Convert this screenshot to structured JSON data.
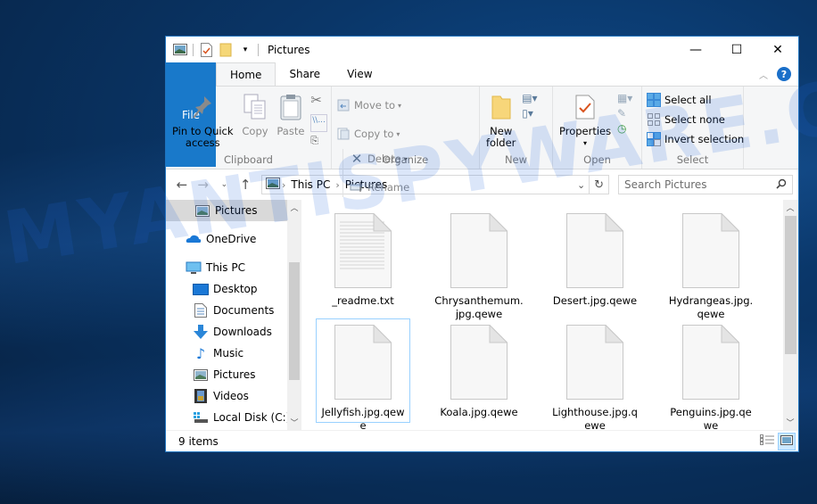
{
  "window": {
    "title": "Pictures",
    "controls": {
      "minimize": "—",
      "maximize": "☐",
      "close": "✕"
    }
  },
  "quick_access_toolbar": {
    "icons": [
      "pictures-folder-icon",
      "properties-icon",
      "new-folder-icon",
      "customize-dropdown-icon"
    ]
  },
  "ribbon_tabs": [
    {
      "label": "File"
    },
    {
      "label": "Home",
      "active": true
    },
    {
      "label": "Share"
    },
    {
      "label": "View"
    }
  ],
  "ribbon": {
    "clipboard": {
      "label": "Clipboard",
      "pin": "Pin to Quick access",
      "pin_line1": "Pin to Quick",
      "pin_line2": "access",
      "copy": "Copy",
      "paste": "Paste"
    },
    "organize": {
      "label": "Organize",
      "move_to": "Move to",
      "copy_to": "Copy to",
      "delete": "Delete",
      "rename": "Rename"
    },
    "new": {
      "label": "New",
      "new_folder_line1": "New",
      "new_folder_line2": "folder"
    },
    "open": {
      "label": "Open",
      "properties": "Properties"
    },
    "select": {
      "label": "Select",
      "select_all": "Select all",
      "select_none": "Select none",
      "invert_selection": "Invert selection"
    }
  },
  "address_bar": {
    "breadcrumbs": [
      "This PC",
      "Pictures"
    ],
    "search_placeholder": "Search Pictures"
  },
  "sidebar": {
    "items": [
      {
        "label": "Pictures",
        "icon": "pictures-icon",
        "selected": true
      },
      {
        "label": "OneDrive",
        "icon": "onedrive-icon"
      },
      {
        "label": "This PC",
        "icon": "this-pc-icon"
      },
      {
        "label": "Desktop",
        "icon": "desktop-icon"
      },
      {
        "label": "Documents",
        "icon": "documents-icon"
      },
      {
        "label": "Downloads",
        "icon": "downloads-icon"
      },
      {
        "label": "Music",
        "icon": "music-icon"
      },
      {
        "label": "Pictures",
        "icon": "pictures-icon"
      },
      {
        "label": "Videos",
        "icon": "videos-icon"
      },
      {
        "label": "Local Disk (C:)",
        "icon": "local-disk-icon"
      }
    ]
  },
  "files": [
    {
      "name": "_readme.txt",
      "type": "text"
    },
    {
      "name": "Chrysanthemum.jpg.qewe",
      "type": "blank"
    },
    {
      "name": "Desert.jpg.qewe",
      "type": "blank"
    },
    {
      "name": "Hydrangeas.jpg.qewe",
      "type": "blank"
    },
    {
      "name": "Jellyfish.jpg.qewe",
      "type": "blank",
      "focused": true
    },
    {
      "name": "Koala.jpg.qewe",
      "type": "blank"
    },
    {
      "name": "Lighthouse.jpg.qewe",
      "type": "blank"
    },
    {
      "name": "Penguins.jpg.qewe",
      "type": "blank"
    }
  ],
  "status_bar": {
    "item_count": "9 items"
  },
  "watermark": "MYANTISPYWARE.COM",
  "colors": {
    "accent": "#1979ca",
    "selection": "#cce8ff",
    "selection_border": "#99d1ff"
  }
}
